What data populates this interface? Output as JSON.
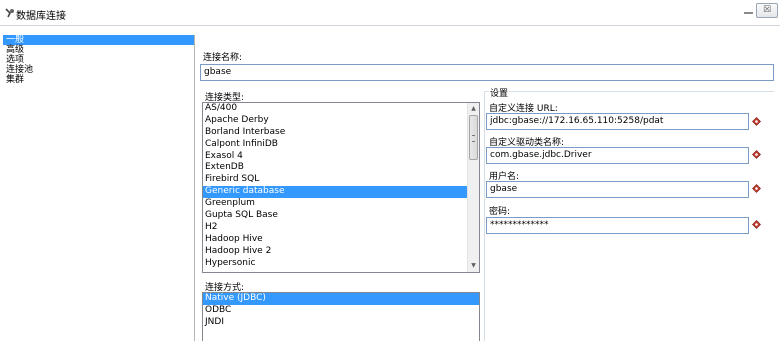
{
  "window": {
    "title": "数据库连接",
    "close_glyph": "☒"
  },
  "nav": {
    "items": [
      {
        "label": "一般",
        "selected": true
      },
      {
        "label": "高级",
        "selected": false
      },
      {
        "label": "选项",
        "selected": false
      },
      {
        "label": "连接池",
        "selected": false
      },
      {
        "label": "集群",
        "selected": false
      }
    ]
  },
  "connection_name": {
    "label": "连接名称:",
    "value": "gbase"
  },
  "connection_type": {
    "label": "连接类型:",
    "items": [
      {
        "label": "AS/400",
        "selected": false
      },
      {
        "label": "Apache Derby",
        "selected": false
      },
      {
        "label": "Borland Interbase",
        "selected": false
      },
      {
        "label": "Calpont InfiniDB",
        "selected": false
      },
      {
        "label": "Exasol 4",
        "selected": false
      },
      {
        "label": "ExtenDB",
        "selected": false
      },
      {
        "label": "Firebird SQL",
        "selected": false
      },
      {
        "label": "Generic database",
        "selected": true
      },
      {
        "label": "Greenplum",
        "selected": false
      },
      {
        "label": "Gupta SQL Base",
        "selected": false
      },
      {
        "label": "H2",
        "selected": false
      },
      {
        "label": "Hadoop Hive",
        "selected": false
      },
      {
        "label": "Hadoop Hive 2",
        "selected": false
      },
      {
        "label": "Hypersonic",
        "selected": false
      }
    ]
  },
  "access_method": {
    "label": "连接方式:",
    "items": [
      {
        "label": "Native (JDBC)",
        "selected": true
      },
      {
        "label": "ODBC",
        "selected": false
      },
      {
        "label": "JNDI",
        "selected": false
      }
    ]
  },
  "settings": {
    "title": "设置",
    "url": {
      "label": "自定义连接 URL:",
      "value": "jdbc:gbase://172.16.65.110:5258/pdat"
    },
    "driver": {
      "label": "自定义驱动类名称:",
      "value": "com.gbase.jdbc.Driver"
    },
    "username": {
      "label": "用户名:",
      "value": "gbase"
    },
    "password": {
      "label": "密码:",
      "value": "*************"
    }
  },
  "colors": {
    "selection": "#3399ff",
    "field_border": "#7a9cc6",
    "required_icon": "#c0392b"
  }
}
